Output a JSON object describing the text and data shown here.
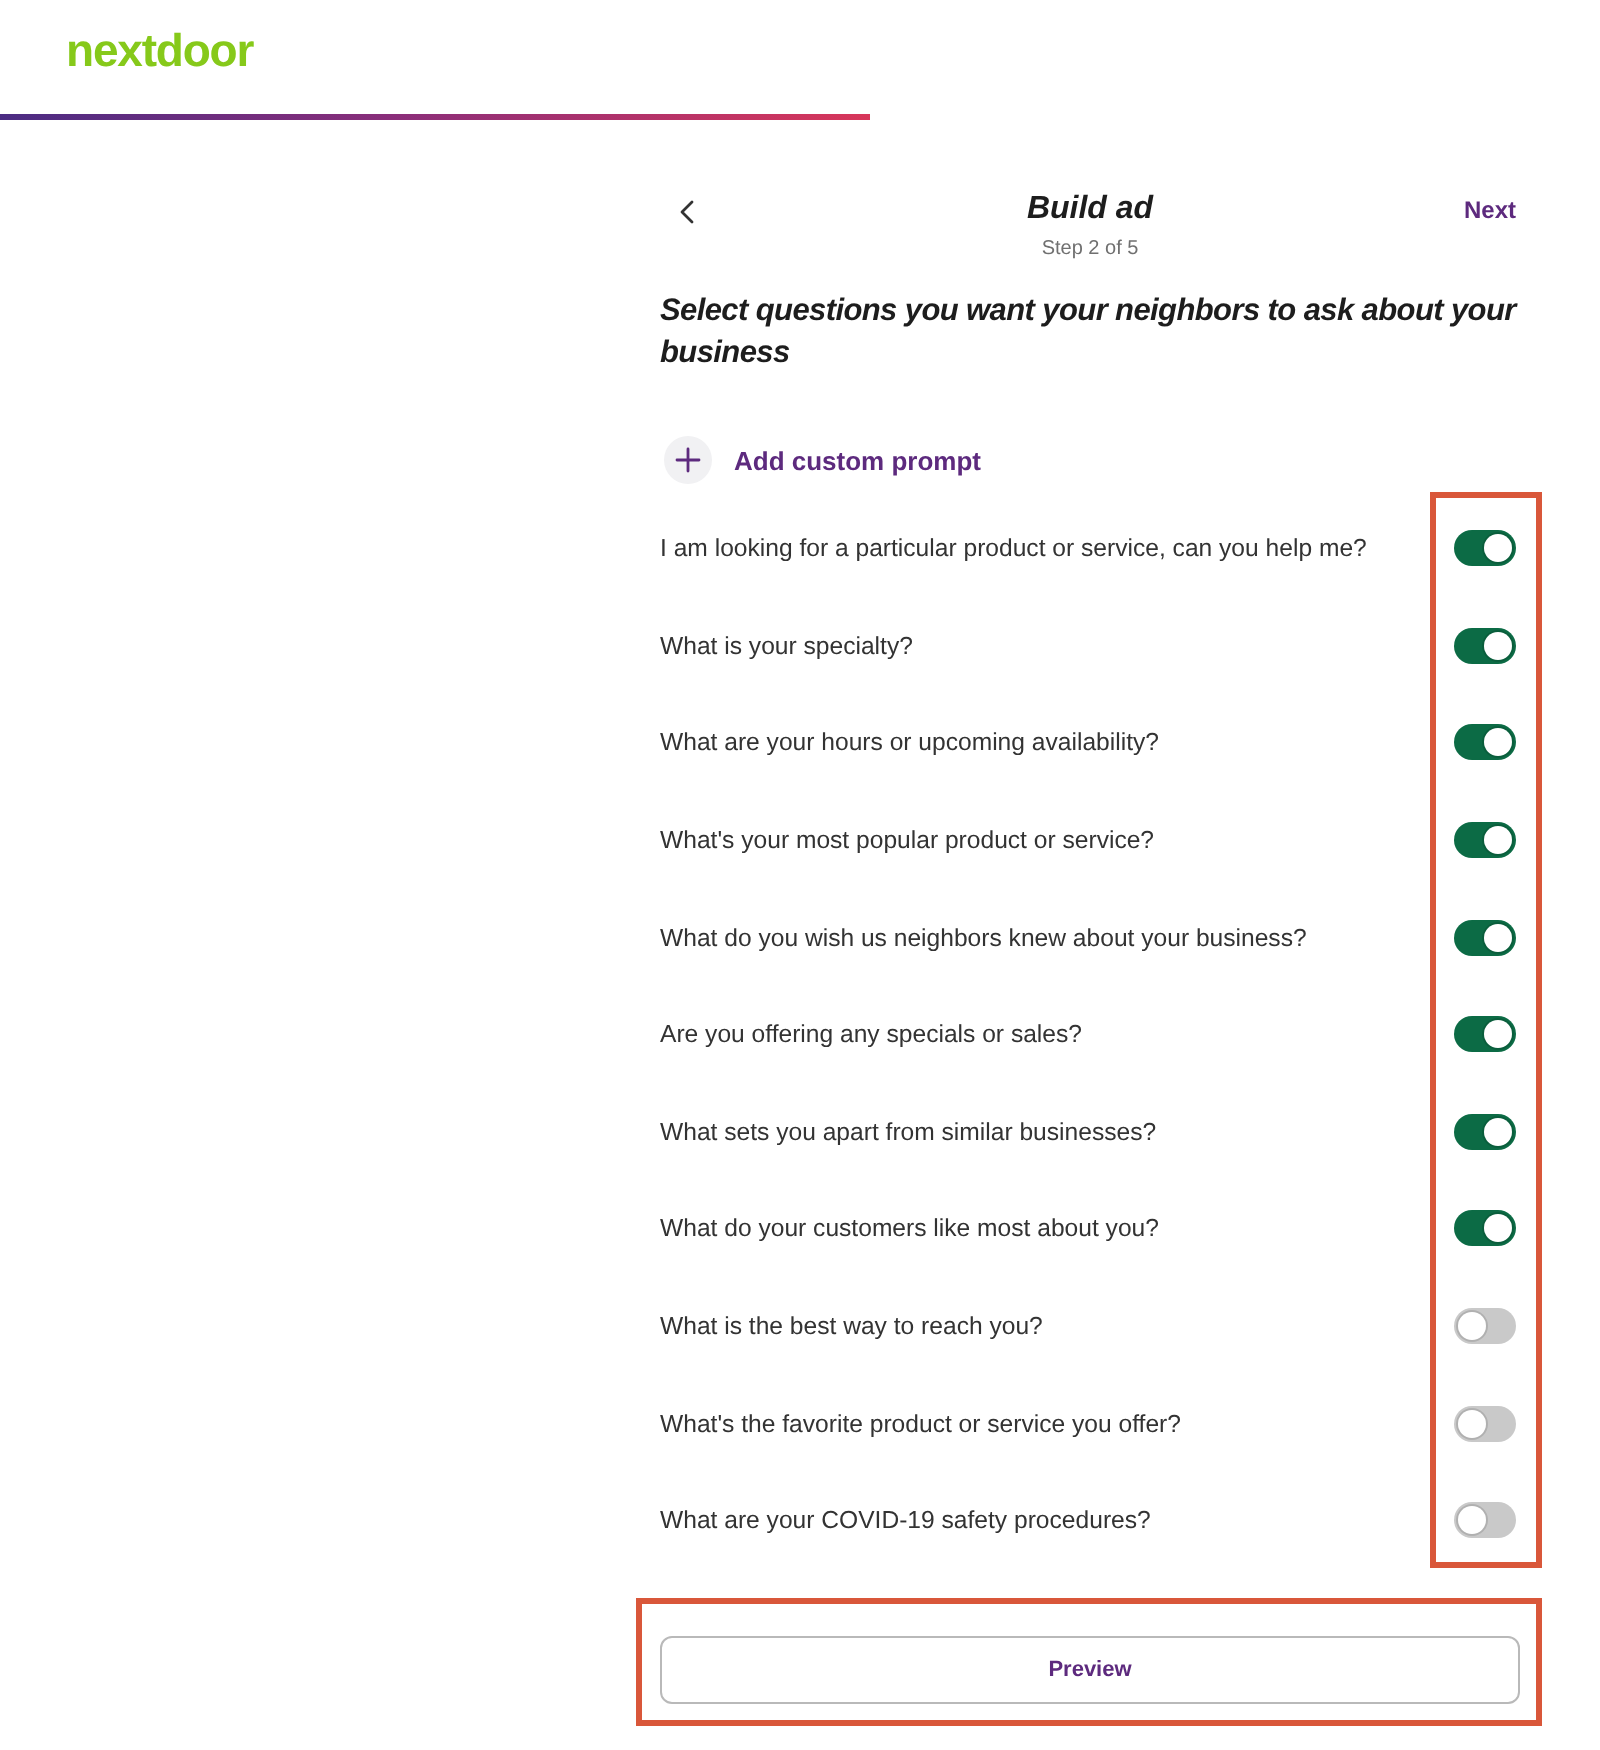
{
  "header": {
    "logo": "nextdoor"
  },
  "nav": {
    "title": "Build ad",
    "step": "Step 2 of 5",
    "next": "Next"
  },
  "heading": "Select questions you want your neighbors to ask about your business",
  "add_prompt": {
    "label": "Add custom prompt"
  },
  "questions": [
    {
      "text": "I am looking for a particular product or service, can you help me?",
      "on": true
    },
    {
      "text": "What is your specialty?",
      "on": true
    },
    {
      "text": "What are your hours or upcoming availability?",
      "on": true
    },
    {
      "text": "What's your most popular product or service?",
      "on": true
    },
    {
      "text": "What do you wish us neighbors knew about your business?",
      "on": true
    },
    {
      "text": "Are you offering any specials or sales?",
      "on": true
    },
    {
      "text": "What sets you apart from similar businesses?",
      "on": true
    },
    {
      "text": "What do your customers like most about you?",
      "on": true
    },
    {
      "text": "What is the best way to reach you?",
      "on": false
    },
    {
      "text": "What's the favorite product or service you offer?",
      "on": false
    },
    {
      "text": "What are your COVID-19 safety procedures?",
      "on": false
    }
  ],
  "footer": {
    "button": "Preview"
  }
}
